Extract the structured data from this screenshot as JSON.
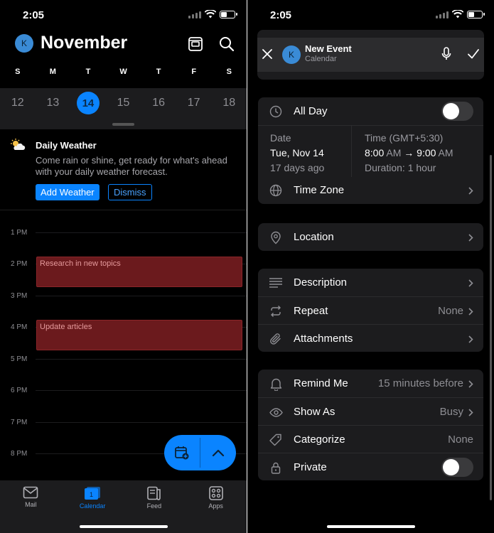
{
  "left": {
    "status_time": "2:05",
    "avatar_initial": "K",
    "month": "November",
    "weekdays": [
      "S",
      "M",
      "T",
      "W",
      "T",
      "F",
      "S"
    ],
    "dates": [
      "12",
      "13",
      "14",
      "15",
      "16",
      "17",
      "18"
    ],
    "selected_date": "14",
    "weather": {
      "title": "Daily Weather",
      "description": "Come rain or shine, get ready for what's ahead with your daily weather forecast.",
      "add_label": "Add Weather",
      "dismiss_label": "Dismiss"
    },
    "hours": [
      "1 PM",
      "2 PM",
      "3 PM",
      "4 PM",
      "5 PM",
      "6 PM",
      "7 PM",
      "8 PM"
    ],
    "events": [
      {
        "title": "Research in new topics",
        "start": "2 PM"
      },
      {
        "title": "Update articles",
        "start": "4 PM"
      }
    ],
    "tabs": [
      {
        "label": "Mail",
        "icon": "mail-icon"
      },
      {
        "label": "Calendar",
        "icon": "calendar-icon",
        "active": true,
        "badge": "1"
      },
      {
        "label": "Feed",
        "icon": "feed-icon"
      },
      {
        "label": "Apps",
        "icon": "apps-icon"
      }
    ],
    "accent": "#0a84ff",
    "event_color": "#6b1a1d"
  },
  "right": {
    "status_time": "2:05",
    "avatar_initial": "K",
    "title": "New Event",
    "subtitle": "Calendar",
    "all_day_label": "All Day",
    "date_label": "Date",
    "date_value": "Tue, Nov 14",
    "date_relative": "17 days ago",
    "time_label": "Time (GMT+5:30)",
    "time_start": "8:00",
    "time_start_ampm": "AM",
    "time_arrow": "→",
    "time_end": "9:00",
    "time_end_ampm": "AM",
    "duration": "Duration: 1 hour",
    "time_zone_label": "Time Zone",
    "location_label": "Location",
    "description_label": "Description",
    "repeat_label": "Repeat",
    "repeat_value": "None",
    "attachments_label": "Attachments",
    "remind_label": "Remind Me",
    "remind_value": "15 minutes before",
    "show_as_label": "Show As",
    "show_as_value": "Busy",
    "categorize_label": "Categorize",
    "categorize_value": "None",
    "private_label": "Private"
  }
}
